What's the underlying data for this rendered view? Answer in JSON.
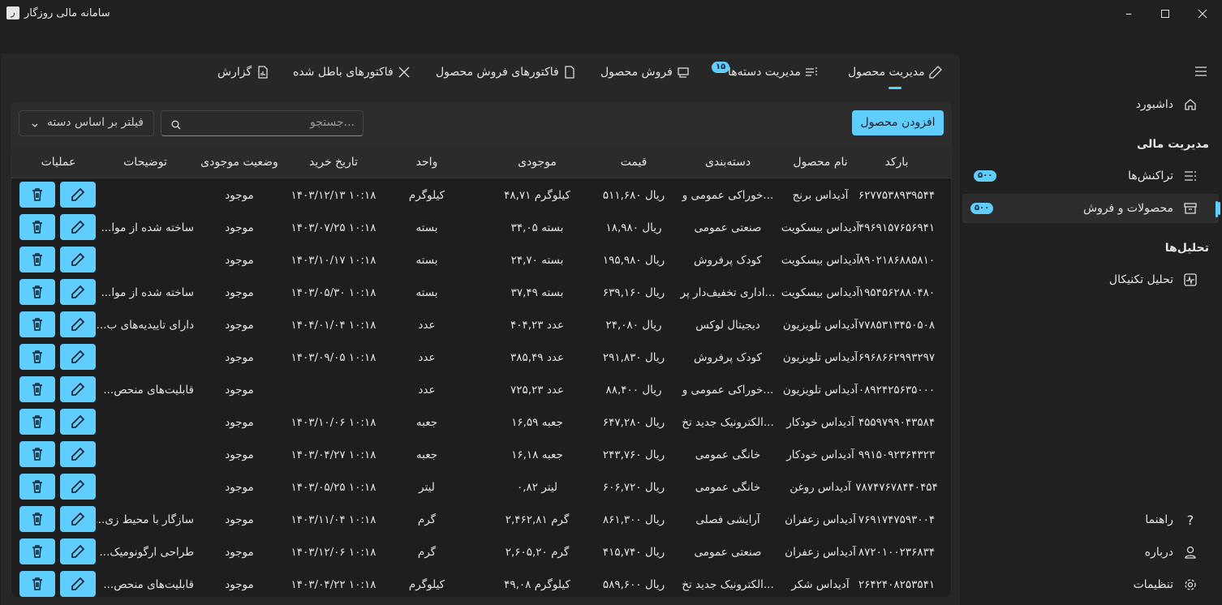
{
  "window": {
    "title": "سامانه مالی روزگار"
  },
  "tabs": [
    {
      "label": "مدیریت محصول",
      "icon": "pencil-icon",
      "active": true
    },
    {
      "label": "مدیریت دسته‌ها",
      "icon": "list-icon",
      "badge": "۱۵"
    },
    {
      "label": "فروش محصول",
      "icon": "cart-icon"
    },
    {
      "label": "فاکتورهای فروش محصول",
      "icon": "document-icon"
    },
    {
      "label": "فاکتورهای باطل شده",
      "icon": "close-icon"
    },
    {
      "label": "گزارش",
      "icon": "report-icon"
    }
  ],
  "toolbar": {
    "add_label": "افزودن محصول",
    "search_placeholder": "جستجو...",
    "filter_label": "فیلتر بر اساس دسته"
  },
  "sidebar": {
    "dashboard": "داشبورد",
    "finance_header": "مدیریت مالی",
    "transactions": "تراکنش‌ها",
    "transactions_badge": "۵۰۰",
    "products": "محصولات و فروش",
    "products_badge": "۵۰۰",
    "analysis_header": "تحلیل‌ها",
    "technical": "تحلیل تکنیکال",
    "help": "راهنما",
    "about": "درباره",
    "settings": "تنظیمات"
  },
  "table": {
    "headers": [
      "بارکد",
      "نام محصول",
      "دسته‌بندی",
      "قیمت",
      "موجودی",
      "واحد",
      "تاریخ خرید",
      "وضعیت موجودی",
      "توضیحات",
      "عملیات"
    ],
    "rows": [
      [
        "۶۲۷۷۵۳۸۹۳۹۵۴۴",
        "آدیداس برنج",
        "خوراکی عمومی و...",
        "۵۱۱,۶۸۰ ریال",
        "۴۸,۷۱ کیلوگرم",
        "کیلوگرم",
        "۱۴۰۳/۱۲/۱۳ ۱۰:۱۸",
        "موجود",
        ""
      ],
      [
        "۴۹۶۹۱۵۷۶۵۶۹۴۱",
        "آدیداس بیسکویت",
        "صنعتی عمومی",
        "۱۸,۹۸۰ ریال",
        "۳۴,۰۵ بسته",
        "بسته",
        "۱۴۰۳/۰۷/۲۵ ۱۰:۱۸",
        "موجود",
        "ساخته شده از موا..."
      ],
      [
        "۸۹۰۲۱۸۶۸۸۵۸۱۰",
        "آدیداس بیسکویت",
        "کودک پرفروش",
        "۱۹۵,۹۸۰ ریال",
        "۲۴,۷۰ بسته",
        "بسته",
        "۱۴۰۳/۱۰/۱۷ ۱۰:۱۸",
        "موجود",
        ""
      ],
      [
        "۱۹۵۴۵۶۲۸۸۰۴۸۰",
        "آدیداس بیسکویت",
        "اداری تخفیف‌دار پر...",
        "۶۳۹,۱۶۰ ریال",
        "۳۷,۴۹ بسته",
        "بسته",
        "۱۴۰۳/۰۵/۳۰ ۱۰:۱۸",
        "موجود",
        "ساخته شده از موا..."
      ],
      [
        "۷۷۸۵۳۱۳۴۵۰۵۰۸",
        "آدیداس تلویزیون",
        "دیجیتال لوکس",
        "۲۴,۰۸۰ ریال",
        "۴۰۴,۲۳ عدد",
        "عدد",
        "۱۴۰۴/۰۱/۰۴ ۱۰:۱۸",
        "موجود",
        "دارای تاییدیه‌های ب..."
      ],
      [
        "۶۹۶۸۶۶۲۹۹۳۲۹۷",
        "آدیداس تلویزیون",
        "کودک پرفروش",
        "۲۹۱,۸۳۰ ریال",
        "۳۸۵,۴۹ عدد",
        "عدد",
        "۱۴۰۳/۰۹/۰۵ ۱۰:۱۸",
        "موجود",
        ""
      ],
      [
        "۰۸۹۲۴۲۵۶۳۵۰۰۰",
        "آدیداس تلویزیون",
        "خوراکی عمومی و...",
        "۸۸,۴۰۰ ریال",
        "۷۲۵,۲۳ عدد",
        "عدد",
        "",
        "موجود",
        "قابلیت‌های منحص..."
      ],
      [
        "۴۵۵۹۷۹۹۰۴۳۵۸۴",
        "آدیداس خودکار",
        "الکترونیک جدید تخ...",
        "۶۴۷,۲۸۰ ریال",
        "۱۶,۵۹ جعبه",
        "جعبه",
        "۱۴۰۳/۱۰/۰۶ ۱۰:۱۸",
        "موجود",
        ""
      ],
      [
        "۹۹۱۵۰۹۲۳۶۴۳۲۳",
        "آدیداس خودکار",
        "خانگی عمومی",
        "۲۴۳,۷۶۰ ریال",
        "۱۶,۱۸ جعبه",
        "جعبه",
        "۱۴۰۳/۰۴/۲۷ ۱۰:۱۸",
        "موجود",
        ""
      ],
      [
        "۷۸۷۴۷۶۷۸۴۴۰۴۵۴",
        "آدیداس روغن",
        "خانگی عمومی",
        "۶۰۶,۷۲۰ ریال",
        "۰,۸۲ لیتر",
        "لیتر",
        "۱۴۰۳/۰۵/۲۵ ۱۰:۱۸",
        "موجود",
        ""
      ],
      [
        "۷۶۹۱۷۴۷۵۹۳۰۰۴",
        "آدیداس زعفران",
        "آرایشی فصلی",
        "۸۶۱,۳۰۰ ریال",
        "۲,۴۶۲,۸۱ گرم",
        "گرم",
        "۱۴۰۳/۱۱/۰۴ ۱۰:۱۸",
        "موجود",
        "سازگار با محیط زی..."
      ],
      [
        "۸۷۲۰۱۰۰۲۳۶۸۳۴",
        "آدیداس زعفران",
        "صنعتی عمومی",
        "۴۱۵,۷۴۰ ریال",
        "۲,۶۰۵,۲۰ گرم",
        "گرم",
        "۱۴۰۳/۱۲/۰۶ ۱۰:۱۸",
        "موجود",
        "طراحی ارگونومیک..."
      ],
      [
        "۲۶۴۲۴۰۸۲۵۳۵۴۱",
        "آدیداس شکر",
        "الکترونیک جدید تخ...",
        "۵۸۹,۶۰۰ ریال",
        "۴۹,۰۸ کیلوگرم",
        "کیلوگرم",
        "۱۴۰۳/۰۴/۲۲ ۱۰:۱۸",
        "موجود",
        "قابلیت‌های منحص..."
      ]
    ]
  },
  "colors": {
    "accent": "#60cdff",
    "background": "#202020",
    "panel": "#2d2d2d"
  }
}
